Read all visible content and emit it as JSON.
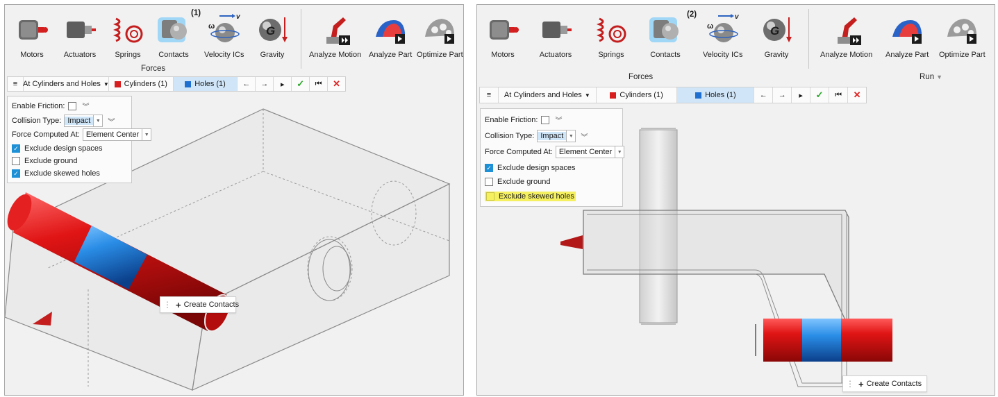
{
  "ribbon": {
    "tools": {
      "motors": "Motors",
      "actuators": "Actuators",
      "springs": "Springs",
      "contacts": "Contacts",
      "velocity": "Velocity ICs",
      "gravity": "Gravity",
      "analyze_motion": "Analyze Motion",
      "analyze_part": "Analyze Part",
      "optimize_part": "Optimize Part"
    },
    "group_forces": "Forces",
    "group_run": "Run",
    "icon_letter_gravity": "G",
    "icon_letter_omega": "ω",
    "icon_letter_v": "v"
  },
  "panels": [
    {
      "step": "(1)"
    },
    {
      "step": "(2)"
    }
  ],
  "contact_bar": {
    "menu_icon": "≡",
    "mode": "At Cylinders and Holes",
    "cylinders": "Cylinders (1)",
    "holes": "Holes (1)",
    "prev": "←",
    "next": "→",
    "play": "▸",
    "apply": "✓",
    "reset": "⏮",
    "close": "✕"
  },
  "options": {
    "enable_friction": "Enable Friction:",
    "collision_type_label": "Collision Type:",
    "collision_type_value": "Impact",
    "force_computed_label": "Force Computed At:",
    "force_computed_value": "Element Center",
    "exclude_design_spaces": "Exclude design spaces",
    "exclude_ground": "Exclude ground",
    "exclude_skewed_holes": "Exclude skewed holes",
    "state_panel1": {
      "design_spaces": true,
      "ground": false,
      "skewed_holes": true
    },
    "state_panel2": {
      "design_spaces": true,
      "ground": false,
      "skewed_holes": false
    }
  },
  "create_contacts": "Create Contacts",
  "colors": {
    "cylinder_red": "#d81e1e",
    "hole_blue": "#1e6fd0",
    "highlight_yellow": "#f5f060",
    "contact_glow": "#3fb7ff",
    "apply_green": "#2aa52a",
    "cancel_red": "#dd2222"
  }
}
